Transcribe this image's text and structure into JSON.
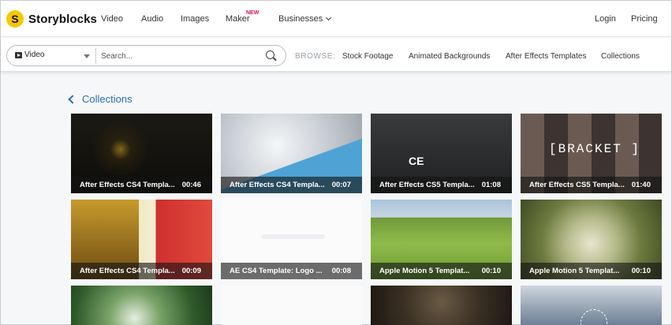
{
  "brand": {
    "name": "Storyblocks",
    "mark": "S"
  },
  "nav": {
    "items": [
      {
        "label": "Video"
      },
      {
        "label": "Audio"
      },
      {
        "label": "Images"
      },
      {
        "label": "Maker",
        "badge": "NEW"
      },
      {
        "label": "Businesses"
      }
    ],
    "login": "Login",
    "pricing": "Pricing"
  },
  "search": {
    "type_value": "Video",
    "placeholder": "Search..."
  },
  "browse": {
    "label": "BROWSE:",
    "links": [
      "Stock Footage",
      "Animated Backgrounds",
      "After Effects Templates",
      "Collections"
    ]
  },
  "page": {
    "back_label": "Collections"
  },
  "cards": [
    {
      "title": "After Effects CS4 Templa...",
      "duration": "00:46"
    },
    {
      "title": "After Effects CS4 Templa...",
      "duration": "00:07"
    },
    {
      "title": "After Effects CS5 Templa...",
      "duration": "01:08"
    },
    {
      "title": "After Effects CS5 Templa...",
      "duration": "01:40"
    },
    {
      "title": "After Effects CS4 Templa...",
      "duration": "00:09"
    },
    {
      "title": "AE CS4 Template: Logo ...",
      "duration": "00:08"
    },
    {
      "title": "Apple Motion 5 Templat...",
      "duration": "00:10"
    },
    {
      "title": "Apple Motion 5 Templat...",
      "duration": "00:10"
    }
  ],
  "thumb_text": {
    "card3": "CE",
    "card4": "[BRACKET ]"
  },
  "colors": {
    "brand_yellow": "#f5c800",
    "link_blue": "#2a6db3",
    "badge_pink": "#d4145a"
  }
}
